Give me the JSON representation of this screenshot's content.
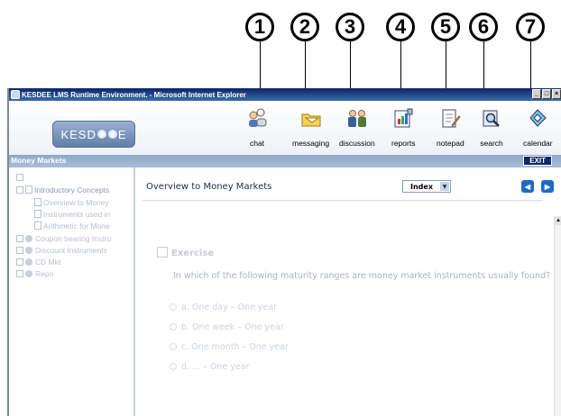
{
  "callouts": [
    "1",
    "2",
    "3",
    "4",
    "5",
    "6",
    "7"
  ],
  "window": {
    "title": "KESDEE LMS Runtime Environment. - Microsoft Internet Explorer",
    "controls": [
      "_",
      "□",
      "×"
    ]
  },
  "header": {
    "logo_left": "KESD",
    "logo_right": "E",
    "tools": [
      {
        "label": "chat",
        "icon": "chat-icon"
      },
      {
        "label": "messaging",
        "icon": "messaging-icon"
      },
      {
        "label": "discussion",
        "icon": "discussion-icon"
      },
      {
        "label": "reports",
        "icon": "reports-icon"
      },
      {
        "label": "notepad",
        "icon": "notepad-icon"
      },
      {
        "label": "search",
        "icon": "search-icon"
      },
      {
        "label": "calendar",
        "icon": "calendar-icon"
      }
    ]
  },
  "subbar": {
    "course_title": "Money Markets",
    "exit_label": "EXIT"
  },
  "sidebar": {
    "root": "Introductory Concepts",
    "pages": [
      "Overview to Money",
      "Instruments used in",
      "Arithmetic for Mone"
    ],
    "sections": [
      "Coupon bearing Instru",
      "Discount Instruments",
      "CD Mkt",
      "Repo"
    ]
  },
  "main": {
    "title": "Overview to Money Markets",
    "index_label": "Index",
    "prev_label": "◀",
    "next_label": "▶",
    "exercise_label": "Exercise",
    "question": "In which of the following maturity ranges are money market instruments usually found?",
    "options": [
      "a. One day – One year",
      "b. One week – One year",
      "c. One month – One year",
      "d. ... – One year"
    ]
  }
}
